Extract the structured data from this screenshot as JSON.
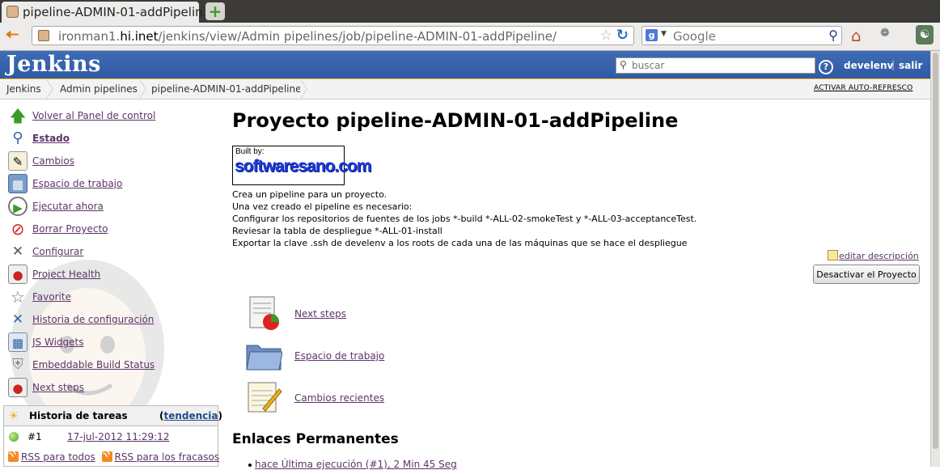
{
  "browser": {
    "tab_title": "pipeline-ADMIN-01-addPipelin...",
    "url_prefix": "ironman1.",
    "url_host": "hi.inet",
    "url_path": "/jenkins/view/Admin pipelines/job/pipeline-ADMIN-01-addPipeline/",
    "search_placeholder": "Google"
  },
  "header": {
    "logo": "Jenkins",
    "search_placeholder": "buscar",
    "user": "develenv",
    "separator": "|",
    "logout": "salir"
  },
  "breadcrumb": {
    "items": [
      "Jenkins",
      "Admin pipelines",
      "pipeline-ADMIN-01-addPipeline"
    ],
    "auto_refresh": "ACTIVAR AUTO-REFRESCO"
  },
  "sidebar": {
    "items": [
      {
        "label": "Volver al Panel de control",
        "icon": "up-arrow-icon"
      },
      {
        "label": "Estado",
        "icon": "magnifier-icon"
      },
      {
        "label": "Cambios",
        "icon": "notepad-icon"
      },
      {
        "label": "Espacio de trabajo",
        "icon": "folder-icon"
      },
      {
        "label": "Ejecutar ahora",
        "icon": "clock-icon"
      },
      {
        "label": "Borrar Proyecto",
        "icon": "no-entry-icon"
      },
      {
        "label": "Configurar",
        "icon": "tools-icon"
      },
      {
        "label": "Project Health",
        "icon": "health-report-icon"
      },
      {
        "label": "Favorite",
        "icon": "star-icon"
      },
      {
        "label": "Historia de configuración",
        "icon": "config-history-icon"
      },
      {
        "label": "JS Widgets",
        "icon": "widgets-icon"
      },
      {
        "label": "Embeddable Build Status",
        "icon": "shield-icon"
      },
      {
        "label": "Next steps",
        "icon": "report-chart-icon"
      }
    ]
  },
  "build_history": {
    "title": "Historia de tareas",
    "trend_open": "(",
    "trend_label": "tendencia",
    "trend_close": ")",
    "builds": [
      {
        "number": "#1",
        "date": "17-jul-2012 11:29:12",
        "status": "success"
      }
    ],
    "rss_all": "RSS para todos",
    "rss_failures": "RSS para los fracasos"
  },
  "main": {
    "title": "Proyecto pipeline-ADMIN-01-addPipeline",
    "built_by_label": "Built by:",
    "built_by_logo": "softwaresano.com",
    "description_lines": [
      "Crea un pipeline para un proyecto.",
      "Una vez creado el pipeline es necesario:",
      "Configurar los repositorios de fuentes de los jobs *-build *-ALL-02-smokeTest y *-ALL-03-acceptanceTest.",
      "Reviesar la tabla de despliegue *-ALL-01-install",
      "Exportar la clave .ssh de develenv a los roots de cada una de las máquinas que se hace el despliegue"
    ],
    "edit_description": "editar descripción",
    "disable_button": "Desactivar el Proyecto",
    "links": [
      {
        "label": "Next steps",
        "icon": "report-chart-icon"
      },
      {
        "label": "Espacio de trabajo",
        "icon": "folder-icon"
      },
      {
        "label": "Cambios recientes",
        "icon": "notepad-icon"
      }
    ],
    "permalinks_title": "Enlaces Permanentes",
    "permalinks": [
      "hace Última ejecución (#1), 2 Min 45 Seg"
    ]
  },
  "colors": {
    "header_blue": "#3465a4",
    "header_stripe": "#f5b339",
    "link": "#5c3566",
    "success_ball": "#4fa01a"
  }
}
